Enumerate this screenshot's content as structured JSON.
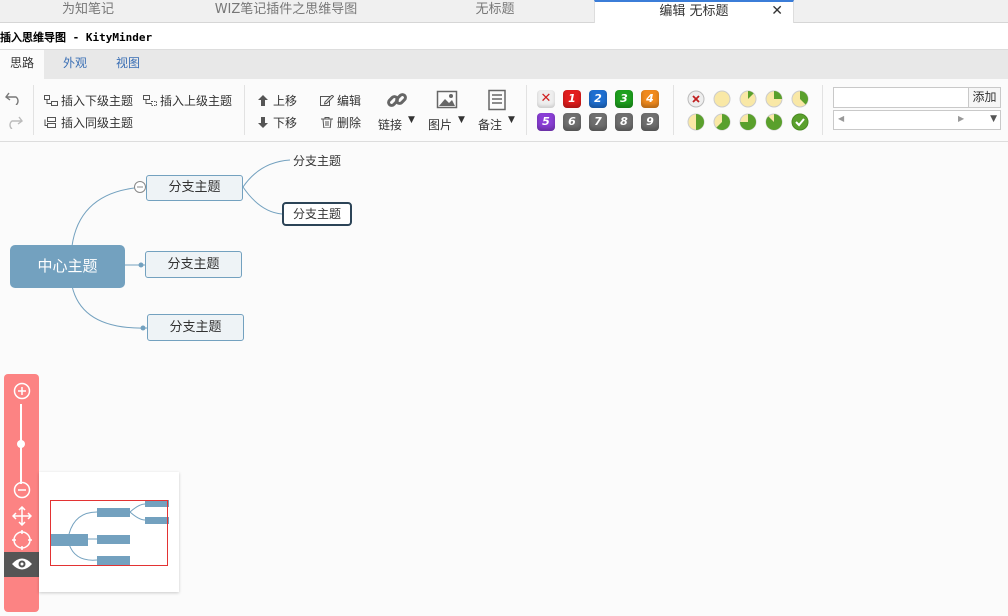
{
  "tabs": [
    {
      "label": "为知笔记"
    },
    {
      "label": "WIZ笔记插件之思维导图"
    },
    {
      "label": "无标题"
    },
    {
      "label": "编辑 无标题",
      "active": true
    }
  ],
  "close_glyph": "✕",
  "window_title": "插入思维导图 - KityMinder",
  "menu_tabs": [
    "思路",
    "外观",
    "视图"
  ],
  "toolbar": {
    "insert_child": "插入下级主题",
    "insert_parent": "插入上级主题",
    "insert_sibling": "插入同级主题",
    "move_up": "上移",
    "move_down": "下移",
    "edit": "编辑",
    "delete": "删除",
    "link": "链接",
    "image": "图片",
    "note": "备注",
    "add": "添加",
    "priorities": [
      "1",
      "2",
      "3",
      "4",
      "5",
      "6",
      "7",
      "8",
      "9"
    ],
    "priority_colors": [
      "#e21d1d",
      "#1f6fd1",
      "#1ea01e",
      "#f08a1e",
      "#8a3fd6",
      "#6f6f6f",
      "#6f6f6f",
      "#6f6f6f",
      "#6f6f6f"
    ]
  },
  "mindmap": {
    "root": "中心主题",
    "branches": [
      "分支主题",
      "分支主题",
      "分支主题"
    ],
    "leaves": [
      "分支主题",
      "分支主题"
    ]
  },
  "colors": {
    "root_fill": "#73a1bf",
    "nav_bar": "#fc8383",
    "viewport_frame": "#e33333"
  }
}
